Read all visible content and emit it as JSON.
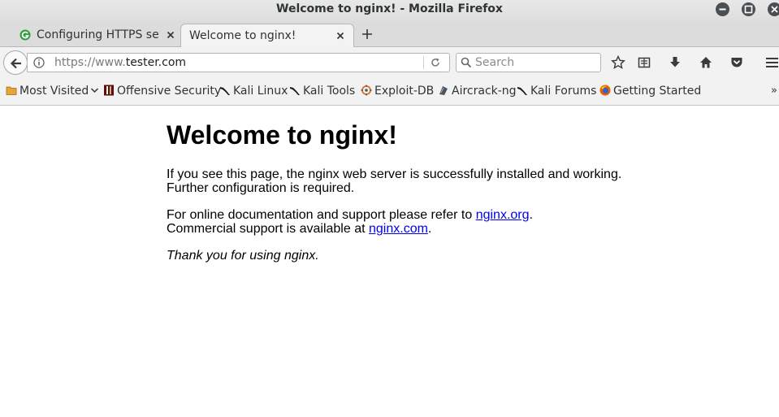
{
  "window": {
    "title": "Welcome to nginx! - Mozilla Firefox"
  },
  "tabs": [
    {
      "label": "Configuring HTTPS se...",
      "favicon": "green-g-icon",
      "active": false
    },
    {
      "label": "Welcome to nginx!",
      "active": true
    }
  ],
  "navbar": {
    "url_prefix": "https://www.",
    "url_host": "tester.com",
    "search_placeholder": "Search"
  },
  "bookmarks": [
    {
      "label": "Most Visited",
      "icon": "folder-icon",
      "has_dropdown": true
    },
    {
      "label": "Offensive Security",
      "icon": "offsec-icon"
    },
    {
      "label": "Kali Linux",
      "icon": "kali-dragon-icon"
    },
    {
      "label": "Kali Tools",
      "icon": "kali-dragon-icon"
    },
    {
      "label": "Exploit-DB",
      "icon": "exploit-db-icon"
    },
    {
      "label": "Aircrack-ng",
      "icon": "aircrack-icon"
    },
    {
      "label": "Kali Forums",
      "icon": "kali-dragon-icon"
    },
    {
      "label": "Getting Started",
      "icon": "firefox-icon"
    }
  ],
  "page": {
    "heading": "Welcome to nginx!",
    "para1_line1": "If you see this page, the nginx web server is successfully installed and working.",
    "para1_line2": "Further configuration is required.",
    "para2_before_link": "For online documentation and support please refer to ",
    "para2_link1": "nginx.org",
    "para2_after_link1": ".",
    "para2_line2_before": "Commercial support is available at ",
    "para2_link2": "nginx.com",
    "para2_line2_after": ".",
    "thanks": "Thank you for using nginx."
  },
  "colors": {
    "link": "#0000ee",
    "window_button": "#4a4f52"
  }
}
